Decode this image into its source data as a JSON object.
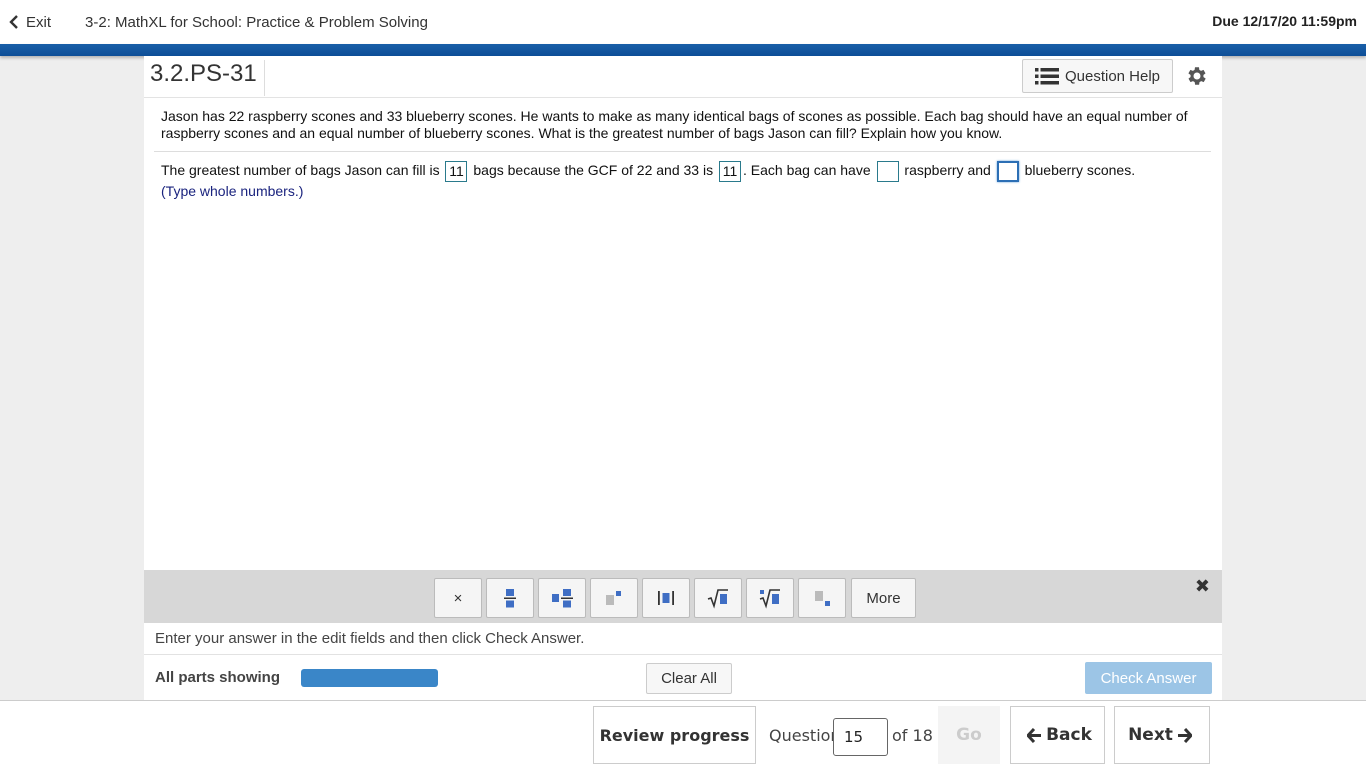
{
  "topbar": {
    "exit_label": "Exit",
    "course_title": "3-2: MathXL for School: Practice & Problem Solving",
    "due": "Due 12/17/20 11:59pm"
  },
  "question": {
    "id": "3.2.PS-31",
    "help_label": "Question Help",
    "text": "Jason has 22 raspberry scones and 33 blueberry scones. He wants to make as many identical bags of scones as possible. Each bag should have an equal number of raspberry scones and an equal number of blueberry scones. What is the greatest number of bags Jason can fill? Explain how you know.",
    "answer_parts": {
      "p1": "The greatest number of bags Jason can fill is",
      "box1": "11",
      "p2": "bags because the GCF of 22 and 33 is",
      "box2": "11",
      "p3": ". Each bag can have",
      "box3": "",
      "p4": "raspberry and",
      "box4": "",
      "p5": "blueberry scones."
    },
    "hint": "(Type whole numbers.)"
  },
  "toolbar": {
    "buttons": [
      "times-symbol",
      "fraction",
      "mixed-number",
      "exponent",
      "absolute-value",
      "square-root",
      "nth-root",
      "subscript"
    ],
    "times_label": "×",
    "more_label": "More"
  },
  "status": {
    "instruction": "Enter your answer in the edit fields and then click Check Answer.",
    "all_parts": "All parts showing",
    "progress_fraction": 1.0,
    "clear_all": "Clear All",
    "check_answer": "Check Answer"
  },
  "nav": {
    "review": "Review progress",
    "question_label": "Question",
    "question_value": "15",
    "of_total": "of 18",
    "go": "Go",
    "back": "Back",
    "next": "Next"
  },
  "colors": {
    "brand_blue": "#1a5fa8",
    "progress": "#3a86c8",
    "check_answer_disabled": "#9cc5e6"
  }
}
